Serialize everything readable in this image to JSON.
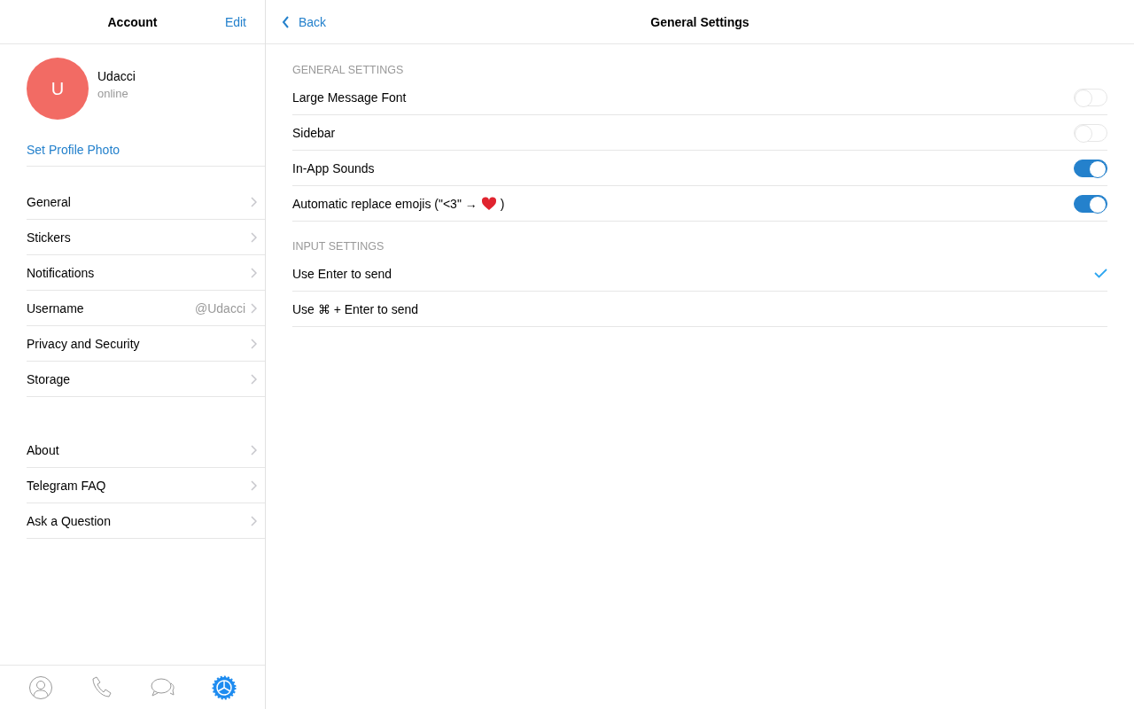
{
  "sidebar": {
    "title": "Account",
    "edit": "Edit",
    "profile": {
      "initial": "U",
      "name": "Udacci",
      "status": "online",
      "set_photo": "Set Profile Photo"
    },
    "groups": [
      [
        {
          "label": "General"
        },
        {
          "label": "Stickers"
        },
        {
          "label": "Notifications"
        },
        {
          "label": "Username",
          "value": "@Udacci"
        },
        {
          "label": "Privacy and Security"
        },
        {
          "label": "Storage"
        }
      ],
      [
        {
          "label": "About"
        },
        {
          "label": "Telegram FAQ"
        },
        {
          "label": "Ask a Question"
        }
      ]
    ],
    "tabs": [
      {
        "kind": "contacts",
        "selected": false
      },
      {
        "kind": "calls",
        "selected": false
      },
      {
        "kind": "chats",
        "selected": false
      },
      {
        "kind": "settings",
        "selected": true
      }
    ]
  },
  "header": {
    "back": "Back",
    "title": "General Settings"
  },
  "sections": [
    {
      "title": "GENERAL SETTINGS",
      "rows": [
        {
          "kind": "toggle",
          "label": "Large Message Font",
          "on": false
        },
        {
          "kind": "toggle",
          "label": "Sidebar",
          "on": false
        },
        {
          "kind": "toggle",
          "label": "In-App Sounds",
          "on": true
        },
        {
          "kind": "toggle",
          "label": "Automatic replace emojis (\"<3\" →",
          "label_after": ")",
          "on": true
        }
      ]
    },
    {
      "title": "INPUT SETTINGS",
      "rows": [
        {
          "kind": "choice",
          "label": "Use Enter to send",
          "selected": true
        },
        {
          "kind": "choice",
          "label": "Use ⌘ + Enter to send",
          "selected": false
        }
      ]
    }
  ]
}
